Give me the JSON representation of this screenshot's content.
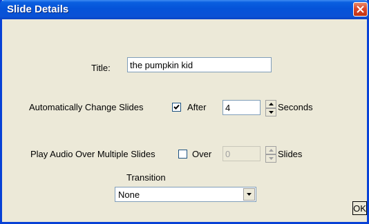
{
  "window": {
    "title": "Slide Details"
  },
  "title_field": {
    "label": "Title:",
    "value": "the pumpkin kid"
  },
  "auto_change": {
    "label": "Automatically Change Slides",
    "checked": true,
    "after_label": "After",
    "seconds_value": "4",
    "unit_label": "Seconds"
  },
  "audio": {
    "label": "Play Audio Over Multiple Slides",
    "checked": false,
    "over_label": "Over",
    "slides_value": "0",
    "unit_label": "Slides"
  },
  "transition": {
    "label": "Transition",
    "selected": "None"
  },
  "buttons": {
    "ok": "OK"
  },
  "icons": {
    "close": "close-icon",
    "spin_up": "arrow-up-icon",
    "spin_down": "arrow-down-icon",
    "dropdown": "chevron-down-icon",
    "check": "check-icon"
  },
  "colors": {
    "titlebar": "#0553d8",
    "window_bg": "#ece9d8",
    "close": "#d9462a"
  }
}
